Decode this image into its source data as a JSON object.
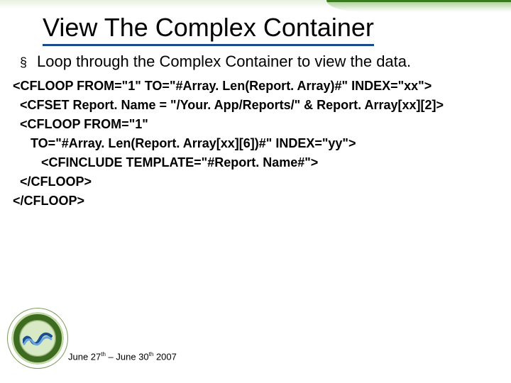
{
  "title": "View The Complex Container",
  "bullet": "Loop through the Complex Container to view the data.",
  "code": {
    "l1": "<CFLOOP FROM=\"1\" TO=\"#Array. Len(Report. Array)#\" INDEX=\"xx\">",
    "l2": "  <CFSET Report. Name = \"/Your. App/Reports/\" & Report. Array[xx][2]>",
    "l3": "  <CFLOOP FROM=\"1\"",
    "l4": "     TO=\"#Array. Len(Report. Array[xx][6])#\" INDEX=\"yy\">",
    "l5": "        <CFINCLUDE TEMPLATE=\"#Report. Name#\">",
    "l6": "  </CFLOOP>",
    "l7": "</CFLOOP>"
  },
  "footer": {
    "part1": "June 27",
    "sup1": "th",
    "part2": " – June 30",
    "sup2": "th",
    "part3": " 2007"
  },
  "logo_alt": "CFUnited — the premier coldfusion technical conference"
}
